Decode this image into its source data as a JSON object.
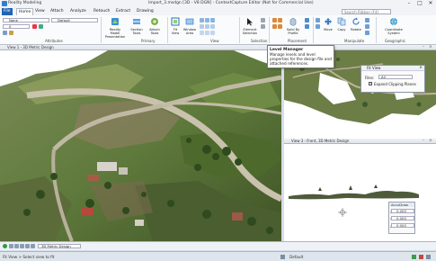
{
  "window": {
    "app_name": "Reality Modeling",
    "title": "Import_3.msdgn [3D - V8 DGN] - ContextCapture Editor (Not for Commercial Use)",
    "minimize": "–",
    "maximize": "□",
    "close": "✕"
  },
  "menu": {
    "tabs": [
      "File",
      "Home",
      "View",
      "Attach",
      "Analyze",
      "Retouch",
      "Extract",
      "Drawing"
    ],
    "search_placeholder": "Search Ribbon (F4)"
  },
  "ribbon": {
    "attributes": {
      "level_value": "None",
      "style_value": "Default",
      "weight_value": "0",
      "label": "Attributes"
    },
    "primary": {
      "buttons": [
        "Reality Model Presentation",
        "Section Tools",
        "Attach Tools"
      ],
      "label": "Primary"
    },
    "view": {
      "buttons": [
        "Fit View",
        "Window Area"
      ],
      "label": "View"
    },
    "selection": {
      "buttons": [
        "Element Selection"
      ],
      "label": "Selection"
    },
    "placement": {
      "buttons": [
        "Solid By Profile"
      ],
      "label": "Placement"
    },
    "manipulate": {
      "buttons": [
        "Move",
        "Copy",
        "Rotate"
      ],
      "label": "Manipulate"
    },
    "geographic": {
      "buttons": [
        "Coordinate System"
      ],
      "label": "Geographic"
    }
  },
  "tooltip": {
    "title": "Level Manager",
    "body": "Manage levels and level properties for the design file and attached references."
  },
  "views": {
    "view1_title": "View 1 - 3D Metric Design",
    "view2_title": "View 2 - Top",
    "view3_title": "View 3 - Front, 3D Metric Design"
  },
  "fit_dialog": {
    "title": "Fit View",
    "files_label": "Files:",
    "files_value": "All",
    "expand_label": "Expand Clipping Planes",
    "expand_checked": true
  },
  "accudraw": {
    "title": "AccuDraw",
    "x_label": "X",
    "x_value": "0.000",
    "y_label": "Y",
    "y_value": "0.000",
    "z_label": "Z",
    "z_value": "0.000"
  },
  "status": {
    "view_groups": "3D Metric Design",
    "prompt": "Fit View > Select view to fit",
    "level": "Default"
  }
}
